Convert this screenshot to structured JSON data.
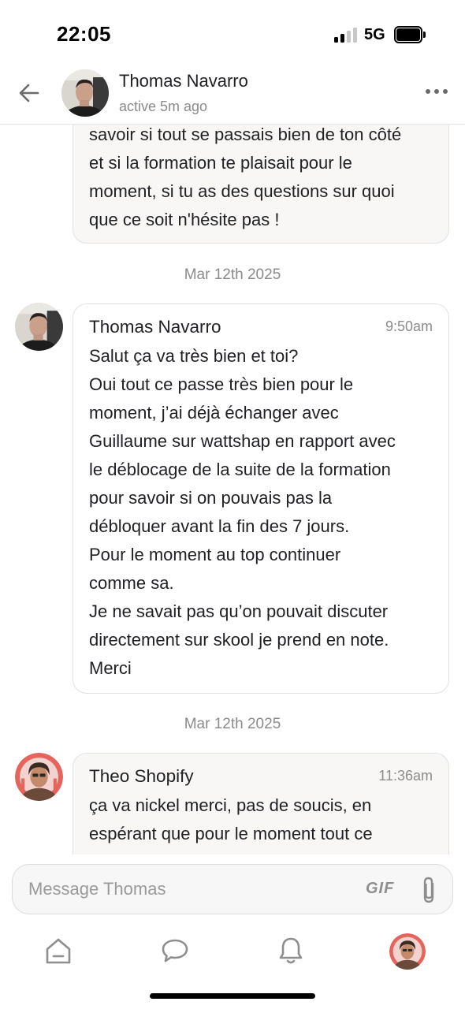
{
  "status_bar": {
    "time": "22:05",
    "network": "5G",
    "icons": [
      "signal-icon",
      "battery-icon"
    ]
  },
  "header": {
    "name": "Thomas Navarro",
    "status": "active 5m ago",
    "icons": [
      "back-arrow-icon",
      "more-dots-icon"
    ]
  },
  "messages": [
    {
      "id": "m1",
      "partial": true,
      "text": "savoir si tout se passais bien de ton côté\net si la formation te plaisait pour le\nmoment, si tu as des questions sur quoi\nque ce soit n'hésite pas !"
    },
    {
      "id": "m2",
      "date": "Mar 12th 2025",
      "author": "Thomas Navarro",
      "time": "9:50am",
      "text": "Salut ça va très bien et toi?\nOui tout ce passe très bien pour le\nmoment, j’ai déjà échanger avec\nGuillaume sur wattshap en rapport avec\nle déblocage de la suite de la formation\npour savoir si on pouvais pas la\ndébloquer avant la fin des 7 jours.\nPour le moment au top continuer\ncomme sa.\nJe ne savait pas qu’on pouvait discuter\ndirectement sur skool je prend en note.\nMerci"
    },
    {
      "id": "m3",
      "date": "Mar 12th 2025",
      "author": "Theo Shopify",
      "time": "11:36am",
      "text": "ça va nickel merci, pas de soucis, en\nespérant que pour le moment tout ce"
    }
  ],
  "composer": {
    "placeholder": "Message Thomas",
    "gif_label": "GIF",
    "icons": [
      "paperclip-icon"
    ]
  },
  "bottom_nav": {
    "items": [
      "home-icon",
      "chat-icon",
      "bell-icon",
      "profile-avatar"
    ]
  },
  "colors": {
    "card_bg": "#f8f7f5",
    "border": "#e2e2e2",
    "muted_text": "#8b8b8b",
    "avatar_theo_bg": "#e5645c"
  }
}
